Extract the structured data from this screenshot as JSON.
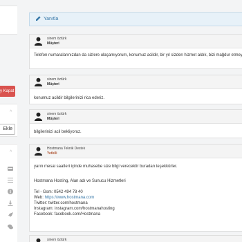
{
  "sidebar": {
    "close_button_label": "y Kapat",
    "add_button_label": "Ekle",
    "chevron_glyph": "^",
    "icons": [
      "list-icon",
      "list-alt-icon",
      "info-icon",
      "download-icon",
      "rocket-icon",
      "comments-icon"
    ]
  },
  "reply": {
    "label": "Yanıtla"
  },
  "messages": [
    {
      "author": "sinem öztürk",
      "role": "Müşteri",
      "body": "Telefon numaralarınızdan da sizlere ulaşamıyorum, konumuz acildir, bir yıl sizden hizmet aldık, bizi mağdur etmeyin. Cevabınızı bekliyoruz. yok, dönüşlerinizi bekliyorum."
    },
    {
      "author": "sinem öztürk",
      "role": "Müşteri",
      "body": "konumuz acildir bilgilerinizi rica ederiz."
    },
    {
      "author": "sinem öztürk",
      "role": "Müşteri",
      "body": "bilgilerinizi acil bekliyoruz."
    },
    {
      "author": "Hostmana Teknik Destek",
      "role": "Yetkili",
      "body": "yarın mesai saatleri içinde muhasebe size bilgi verecektir buradan teşekkürler.",
      "signature": {
        "company": "Hostmana Hosting, Alan adı ve Sunucu Hizmetleri",
        "phone": "Tel - Gsm: 0542 494 78 40",
        "web_label": "Web: ",
        "web_link": "https://www.hostmana.com",
        "twitter": "Twitter: twitter.com/hostmana",
        "instagram": "Instagram: instagram.com/hostmanahosting",
        "facebook": "Facebook: facebook.com/Hostmana"
      }
    },
    {
      "author": "sinem öztürk",
      "role": ""
    }
  ],
  "colors": {
    "reply_accent": "#3778a8",
    "close_button": "#d9534f",
    "page_bg": "#f3f4f5"
  }
}
